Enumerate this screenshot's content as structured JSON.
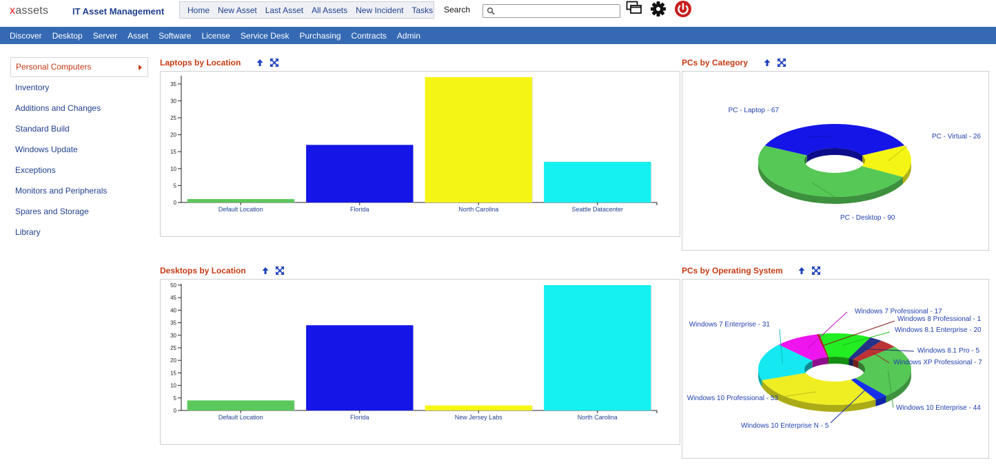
{
  "app": {
    "logo_prefix": "x",
    "logo_suffix": "assets",
    "title": "IT Asset Management"
  },
  "quicknav": [
    "Home",
    "New Asset",
    "Last Asset",
    "All Assets",
    "New Incident",
    "Tasks"
  ],
  "search": {
    "label": "Search",
    "value": "",
    "icon": "search-icon"
  },
  "header_icons": [
    "windows-icon",
    "gear-icon",
    "power-icon"
  ],
  "menu": [
    "Discover",
    "Desktop",
    "Server",
    "Asset",
    "Software",
    "License",
    "Service Desk",
    "Purchasing",
    "Contracts",
    "Admin"
  ],
  "sidebar": {
    "items": [
      "Personal Computers",
      "Inventory",
      "Additions and Changes",
      "Standard Build",
      "Windows Update",
      "Exceptions",
      "Monitors and Peripherals",
      "Spares and Storage",
      "Library"
    ],
    "active": 0
  },
  "panels": {
    "laptops": {
      "title": "Laptops by Location"
    },
    "desktops": {
      "title": "Desktops by Location"
    },
    "category": {
      "title": "PCs by Category"
    },
    "os": {
      "title": "PCs by Operating System"
    }
  },
  "chart_data": [
    {
      "type": "bar",
      "categories": [
        "Default Location",
        "Florida",
        "North Carolina",
        "Seattle Datacenter"
      ],
      "values": [
        1,
        17,
        37,
        12
      ],
      "colors": [
        "#5ac85a",
        "#1515e8",
        "#f5f515",
        "#15f0f0"
      ],
      "yticks": [
        0,
        5,
        10,
        15,
        20,
        25,
        30,
        35
      ],
      "ylim": [
        0,
        37
      ]
    },
    {
      "type": "bar",
      "categories": [
        "Default Location",
        "Florida",
        "New Jersey Labs",
        "North Carolina"
      ],
      "values": [
        4,
        34,
        2,
        50
      ],
      "colors": [
        "#5ac85a",
        "#1515e8",
        "#f5f515",
        "#15f0f0"
      ],
      "yticks": [
        0,
        5,
        10,
        15,
        20,
        25,
        30,
        35,
        40,
        45,
        50
      ],
      "ylim": [
        0,
        50
      ]
    },
    {
      "type": "pie",
      "labels": [
        "PC - Laptop - 67",
        "PC - Virtual - 26",
        "PC - Desktop - 90"
      ],
      "values": [
        67,
        26,
        90
      ],
      "colors": [
        "#1515e8",
        "#f5f515",
        "#55c855"
      ]
    },
    {
      "type": "pie",
      "labels": [
        "Windows 7 Enterprise - 31",
        "Windows 7 Professional - 17",
        "Windows 8 Professional - 1",
        "Windows 8.1 Enterprise - 20",
        "Windows 8.1 Pro - 5",
        "Windows XP Professional - 7",
        "Windows 10 Enterprise - 44",
        "Windows 10 Enterprise N - 5",
        "Windows 10 Professional - 53"
      ],
      "values": [
        31,
        17,
        1,
        20,
        5,
        7,
        44,
        5,
        53
      ],
      "colors": [
        "#15e8f0",
        "#ee15ee",
        "#aa2222",
        "#22ee22",
        "#223388",
        "#bb3333",
        "#55c855",
        "#1530e8",
        "#eeee22"
      ]
    }
  ]
}
